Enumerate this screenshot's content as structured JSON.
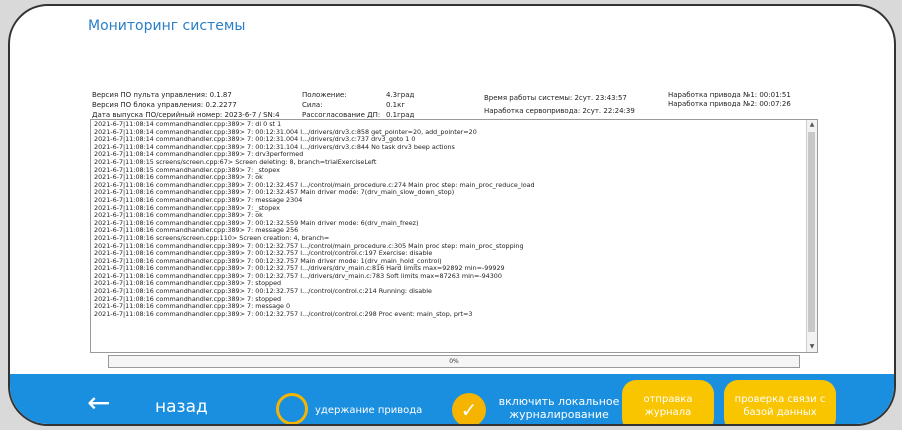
{
  "title": "Мониторинг системы",
  "info": {
    "remote_fw": "Версия ПО пульта управления: 0.1.87",
    "block_fw": "Версия ПО блока управления: 0.2.2277",
    "release": "Дата выпуска ПО/серийный номер: 2023-6-7 / SN:4",
    "position_label": "Положение:",
    "position_value": "4.3град",
    "force_label": "Сила:",
    "force_value": "0.1кг",
    "mismatch_label": "Рассогласование ДП:",
    "mismatch_value": "0.1град",
    "uptime": "Время работы системы: 2сут. 23:43:57",
    "servo_runtime": "Наработка сервопривода: 2сут. 22:24:39",
    "drive1": "Наработка привода №1: 00:01:51",
    "drive2": "Наработка привода №2: 00:07:26"
  },
  "log_lines": [
    "2021-6-7|11:08:14 commandhandler.cpp:389> 7: dl 0 st 1",
    "2021-6-7|11:08:14 commandhandler.cpp:389> 7: 00:12:31.004 I.../drivers/drv3.c:858 get_pointer=20, add_pointer=20",
    "2021-6-7|11:08:14 commandhandler.cpp:389> 7: 00:12:31.004 I.../drivers/drv3.c:737 drv3_goto 1 0",
    "2021-6-7|11:08:14 commandhandler.cpp:389> 7: 00:12:31.104 I.../drivers/drv3.c:844 No task drv3 beep actions",
    "2021-6-7|11:08:14 commandhandler.cpp:389> 7: drv3performed",
    "2021-6-7|11:08:15 screens/screen.cpp:67> Screen deleting: 8, branch=trialExerciseLeft",
    "2021-6-7|11:08:15 commandhandler.cpp:389> 7: _stopex",
    "2021-6-7|11:08:16 commandhandler.cpp:389> 7: ok",
    "2021-6-7|11:08:16 commandhandler.cpp:389> 7: 00:12:32.457 I.../control/main_procedure.c:274 Main proc step: main_proc_reduce_load",
    "2021-6-7|11:08:16 commandhandler.cpp:389> 7: 00:12:32.457 Main driver mode: 7(drv_main_slow_down_stop)",
    "2021-6-7|11:08:16 commandhandler.cpp:389> 7: message 2304",
    "2021-6-7|11:08:16 commandhandler.cpp:389> 7: _stopex",
    "2021-6-7|11:08:16 commandhandler.cpp:389> 7: ok",
    "2021-6-7|11:08:16 commandhandler.cpp:389> 7: 00:12:32.559 Main driver mode: 6(drv_main_freez)",
    "2021-6-7|11:08:16 commandhandler.cpp:389> 7: message 256",
    "2021-6-7|11:08:16 screens/screen.cpp:110> Screen creation: 4, branch=",
    "2021-6-7|11:08:16 commandhandler.cpp:389> 7: 00:12:32.757 I.../control/main_procedure.c:305 Main proc step: main_proc_stopping",
    "2021-6-7|11:08:16 commandhandler.cpp:389> 7: 00:12:32.757 I.../control/control.c:197 Exercise: disable",
    "2021-6-7|11:08:16 commandhandler.cpp:389> 7: 00:12:32.757 Main driver mode: 1(drv_main_hold_control)",
    "2021-6-7|11:08:16 commandhandler.cpp:389> 7: 00:12:32.757 I.../drivers/drv_main.c:816 Hard limits max=92892 min=-99929",
    "2021-6-7|11:08:16 commandhandler.cpp:389> 7: 00:12:32.757 I.../drivers/drv_main.c:783 Soft limits max=87263 min=-94300",
    "2021-6-7|11:08:16 commandhandler.cpp:389> 7: stopped",
    "2021-6-7|11:08:16 commandhandler.cpp:389> 7: 00:12:32.757 I.../control/control.c:214 Running: disable",
    "2021-6-7|11:08:16 commandhandler.cpp:389> 7: stopped",
    "2021-6-7|11:08:16 commandhandler.cpp:389> 7: message 0",
    "2021-6-7|11:08:16 commandhandler.cpp:389> 7: 00:12:32.757 I.../control/control.c:298 Proc event: main_stop, prt=3"
  ],
  "progress_text": "0%",
  "progress_value": 0,
  "footer": {
    "back_label": "назад",
    "hold_label": "удержание привода",
    "local_log_label": "включить локальное журналирование",
    "send_log_label": "отправка журнала",
    "db_check_label": "проверка связи с базой данных"
  },
  "colors": {
    "accent": "#2a7fc9",
    "bar": "#1a8fe0",
    "button": "#f9c400",
    "toggle": "#f5b400"
  },
  "icons": {
    "back": "back-arrow-icon",
    "check": "check-icon"
  }
}
